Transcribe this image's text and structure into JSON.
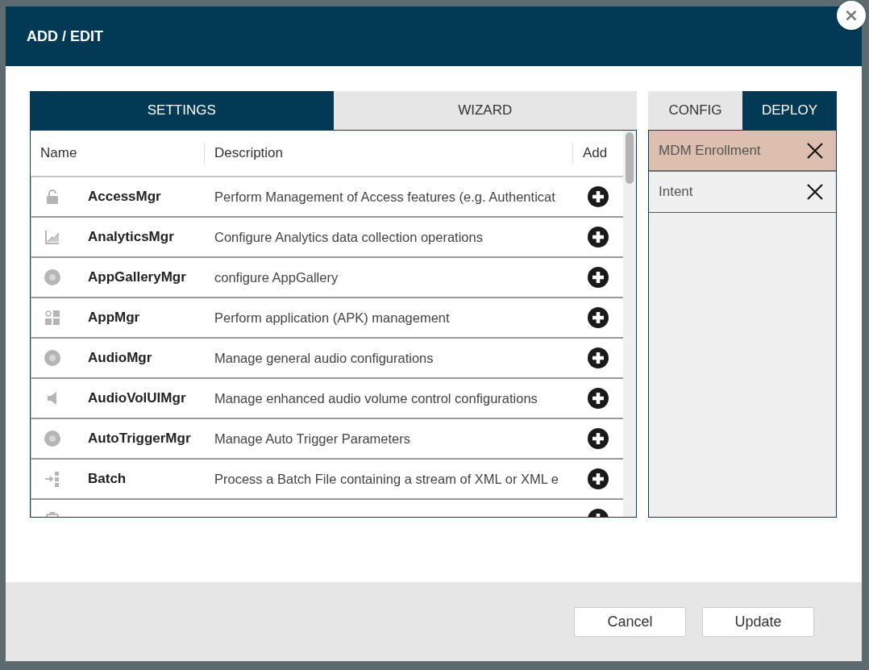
{
  "dialog": {
    "title": "ADD / EDIT",
    "close": "×"
  },
  "left_tabs": [
    {
      "label": "SETTINGS",
      "selected": true
    },
    {
      "label": "WIZARD",
      "selected": false
    }
  ],
  "table": {
    "columns": [
      "Name",
      "Description",
      "Add"
    ],
    "rows": [
      {
        "kind": "lock",
        "name": "AccessMgr",
        "description": "Perform Management of Access features (e.g. Authenticat"
      },
      {
        "kind": "chart",
        "name": "AnalyticsMgr",
        "description": "Configure Analytics data collection operations"
      },
      {
        "kind": "sn",
        "name": "AppGalleryMgr",
        "description": "configure AppGallery"
      },
      {
        "kind": "apps",
        "name": "AppMgr",
        "description": "Perform application (APK) management"
      },
      {
        "kind": "sn",
        "name": "AudioMgr",
        "description": "Manage general audio configurations"
      },
      {
        "kind": "speaker",
        "name": "AudioVolUIMgr",
        "description": "Manage enhanced audio volume control configurations"
      },
      {
        "kind": "sn",
        "name": "AutoTriggerMgr",
        "description": "Manage Auto Trigger Parameters"
      },
      {
        "kind": "batch",
        "name": "Batch",
        "description": "Process a Batch File containing a stream of XML or XML e"
      },
      {
        "kind": "battery"
      }
    ]
  },
  "right_tabs": [
    {
      "label": "CONFIG",
      "selected": false
    },
    {
      "label": "DEPLOY",
      "selected": true
    }
  ],
  "deploy_items": [
    {
      "label": "MDM Enrollment",
      "selected": true
    },
    {
      "label": "Intent",
      "selected": false
    }
  ],
  "buttons": [
    "Cancel",
    "Update"
  ]
}
